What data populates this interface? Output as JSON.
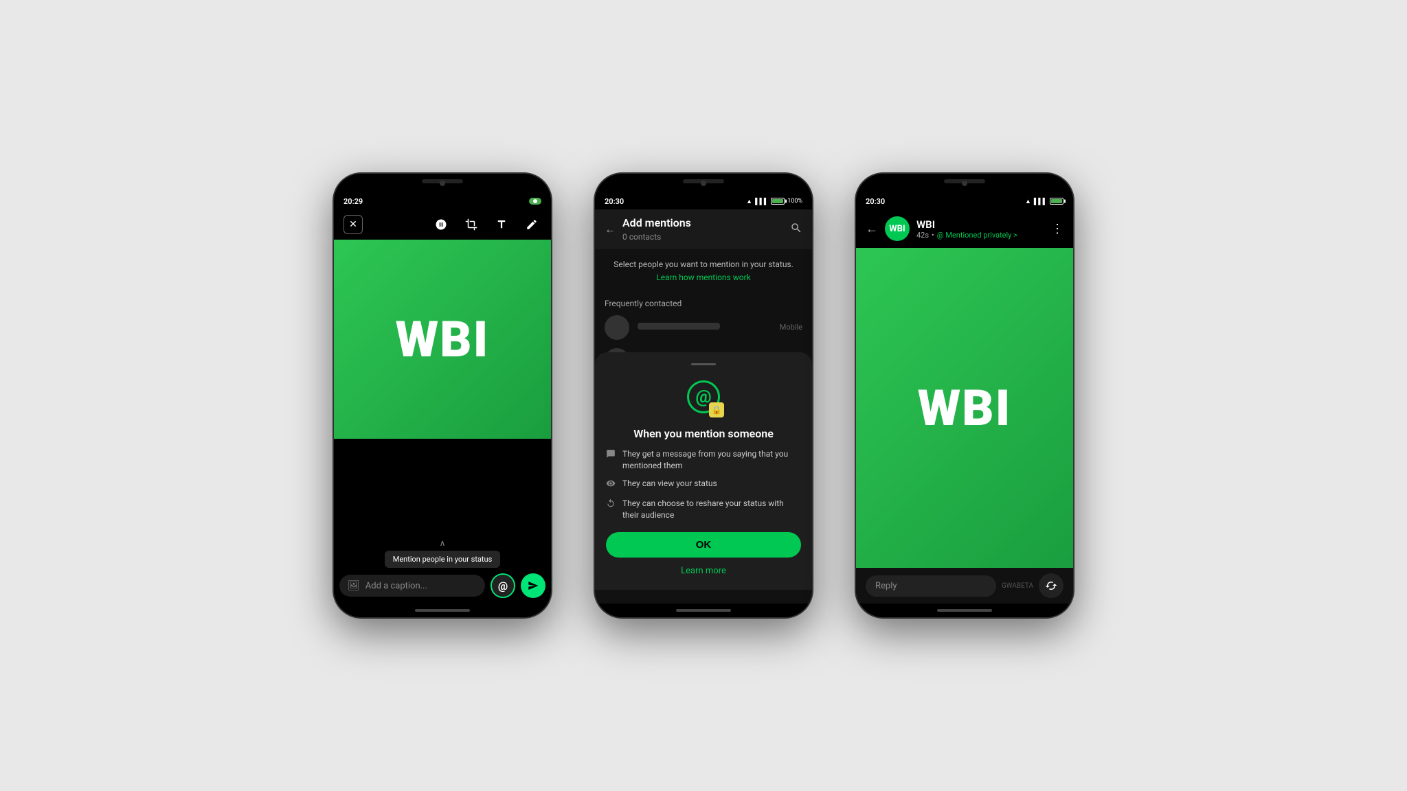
{
  "background_color": "#e8e8e8",
  "phone1": {
    "status_time": "20:29",
    "toolbar_icons": [
      "sticker",
      "crop",
      "text",
      "draw"
    ],
    "wbi_logo": "WBI",
    "chevron_label": "^",
    "tooltip_text": "Mention people in your status",
    "caption_placeholder": "Add a caption...",
    "at_symbol": "@",
    "send_symbol": "➤"
  },
  "phone2": {
    "status_time": "20:30",
    "battery_level": "100%",
    "header_title": "Add mentions",
    "header_subtitle": "0 contacts",
    "info_text": "Select people you want to mention in your status.",
    "info_link": "Learn how mentions work",
    "section_label": "Frequently contacted",
    "contact_type": "Mobile",
    "sheet_title": "When you mention someone",
    "points": [
      "They get a message from you saying that you mentioned them",
      "They can view your status",
      "They can choose to reshare your status with their audience"
    ],
    "ok_label": "OK",
    "learn_more": "Learn more"
  },
  "phone3": {
    "status_time": "20:30",
    "header_name": "WBI",
    "header_avatar": "WBI",
    "header_time": "42s",
    "mentioned_badge": "@ Mentioned privately >",
    "wbi_logo": "WBI",
    "reply_placeholder": "Reply",
    "watermark": "GWABETA",
    "reshare_symbol": "⇄"
  }
}
